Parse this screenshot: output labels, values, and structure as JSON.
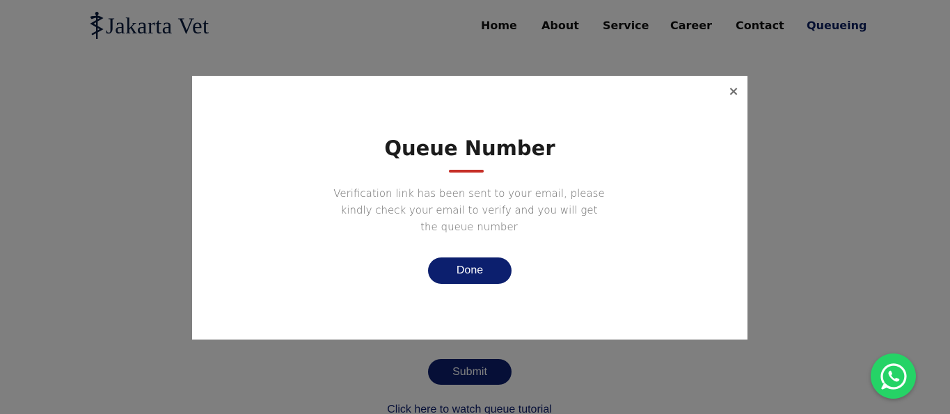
{
  "brand": {
    "name": "Jakarta Vet",
    "logo_icon": "caduceus-icon",
    "color": "#0b1d3f"
  },
  "nav": {
    "items": [
      {
        "label": "Home"
      },
      {
        "label": "About"
      },
      {
        "label": "Service"
      },
      {
        "label": "Career"
      },
      {
        "label": "Contact"
      },
      {
        "label": "Queueing",
        "active": true
      }
    ],
    "active_color": "#0c2163"
  },
  "page": {
    "submit_label": "Submit",
    "tutorial_link": "Click here to watch queue tutorial"
  },
  "modal": {
    "title": "Queue Number",
    "message": "Verification link has been sent to your email, please kindly check your email to verify and you will get the queue number",
    "done_label": "Done",
    "close_symbol": "×",
    "accent_color": "#c62f27"
  },
  "colors": {
    "button": "#0c1f6e",
    "whatsapp": "#25d366",
    "overlay": "rgba(0,0,0,0.5)"
  },
  "floating": {
    "whatsapp_icon": "whatsapp-icon"
  }
}
